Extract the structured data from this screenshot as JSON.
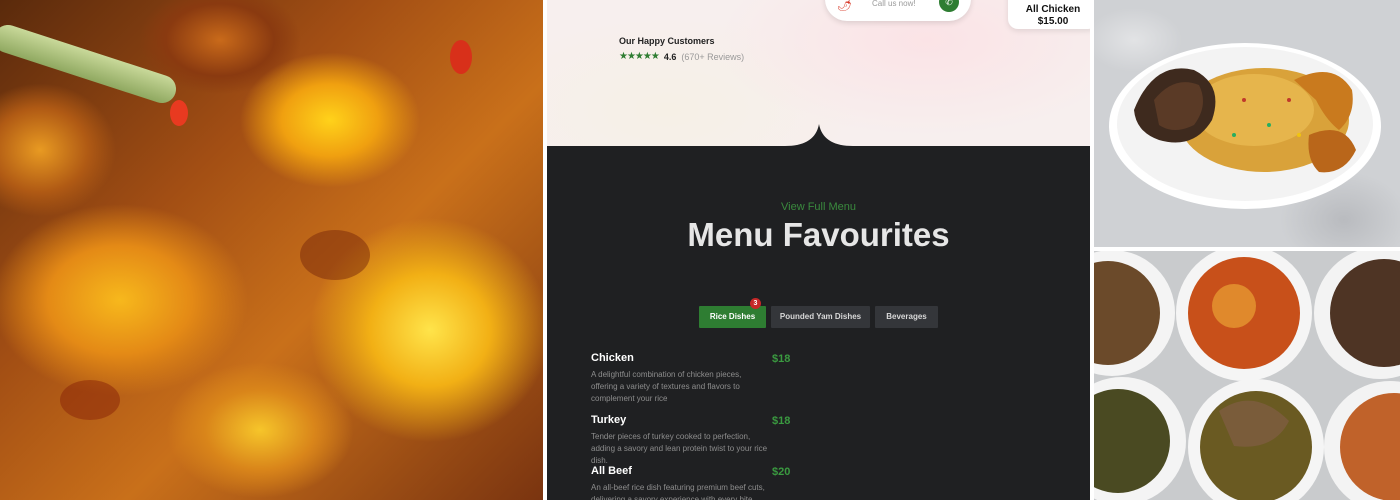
{
  "hero": {
    "call_text": "Call us now!",
    "promo_title": "All Chicken",
    "promo_price": "$15.00",
    "customers_title": "Our Happy Customers",
    "stars": "★★★★★",
    "rating": "4.6",
    "reviews": "(670+ Reviews)"
  },
  "menu": {
    "view_full_menu": "View Full Menu",
    "title": "Menu Favourites",
    "tabs": [
      {
        "label": "Rice Dishes",
        "badge": "3"
      },
      {
        "label": "Pounded Yam Dishes"
      },
      {
        "label": "Beverages"
      }
    ],
    "items": [
      {
        "name": "Chicken",
        "price": "$18",
        "description": "A delightful combination of chicken pieces, offering a variety of textures and flavors to complement your rice"
      },
      {
        "name": "Turkey",
        "price": "$18",
        "description": "Tender pieces of turkey cooked to perfection, adding a savory and lean protein twist to your rice dish."
      },
      {
        "name": "All Beef",
        "price": "$20",
        "description": "An all-beef rice dish featuring premium beef cuts, delivering a savory experience with every bite."
      }
    ]
  },
  "colors": {
    "accent_green": "#2e7d32",
    "panel_dark": "#1f2022",
    "badge_red": "#c62828"
  },
  "icons": {
    "call_button": "phone-icon",
    "decoration": "chili-icon"
  }
}
